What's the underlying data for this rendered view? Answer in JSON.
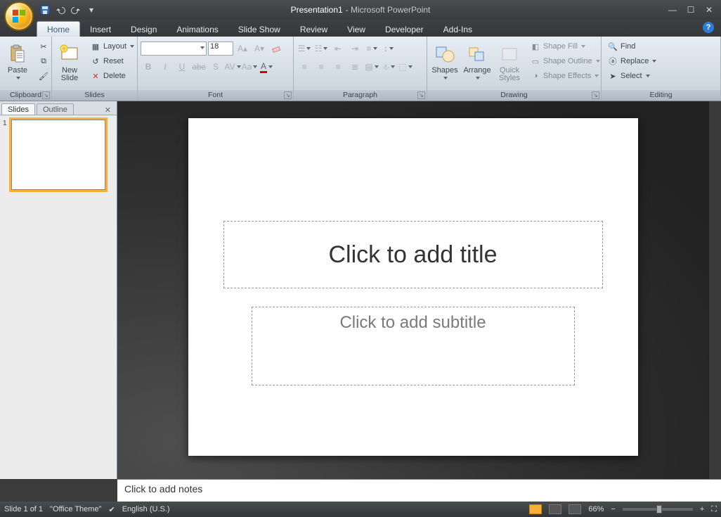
{
  "title": {
    "doc": "Presentation1",
    "sep": " - ",
    "app": "Microsoft PowerPoint"
  },
  "tabs": [
    "Home",
    "Insert",
    "Design",
    "Animations",
    "Slide Show",
    "Review",
    "View",
    "Developer",
    "Add-Ins"
  ],
  "active_tab": "Home",
  "ribbon": {
    "clipboard": {
      "label": "Clipboard",
      "paste": "Paste",
      "cut": "Cut",
      "copy": "Copy",
      "fmt": "Format Painter"
    },
    "slides": {
      "label": "Slides",
      "new": "New\nSlide",
      "layout": "Layout",
      "reset": "Reset",
      "delete": "Delete"
    },
    "font": {
      "label": "Font",
      "size": "18"
    },
    "paragraph": {
      "label": "Paragraph"
    },
    "drawing": {
      "label": "Drawing",
      "shapes": "Shapes",
      "arrange": "Arrange",
      "quick": "Quick\nStyles",
      "fill": "Shape Fill",
      "outline": "Shape Outline",
      "effects": "Shape Effects"
    },
    "editing": {
      "label": "Editing",
      "find": "Find",
      "replace": "Replace",
      "select": "Select"
    }
  },
  "leftpanel": {
    "tab1": "Slides",
    "tab2": "Outline",
    "slide_num": "1"
  },
  "slide": {
    "title_ph": "Click to add title",
    "sub_ph": "Click to add subtitle"
  },
  "notes": {
    "placeholder": "Click to add notes"
  },
  "status": {
    "slide": "Slide 1 of 1",
    "theme": "\"Office Theme\"",
    "lang": "English (U.S.)",
    "zoom": "66%"
  }
}
